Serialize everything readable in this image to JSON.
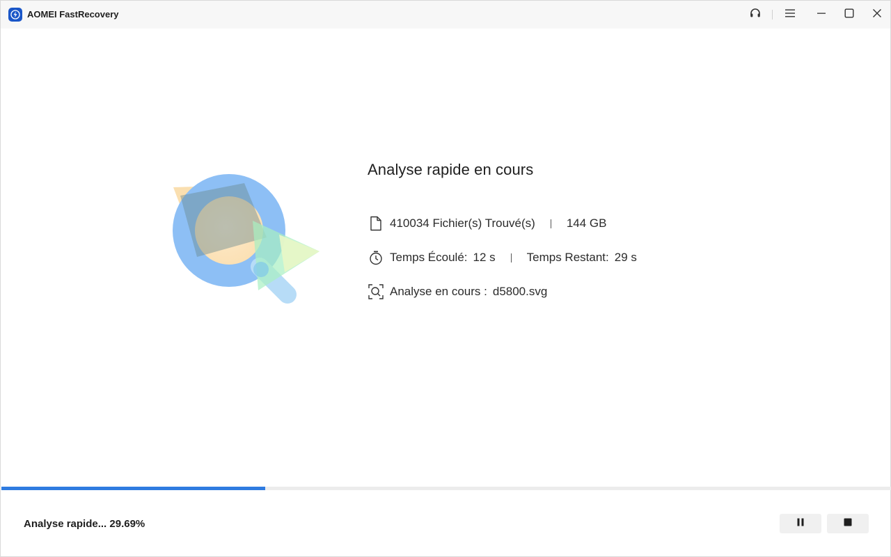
{
  "window": {
    "title": "AOMEI FastRecovery",
    "icons": [
      "lightning-logo-icon",
      "headset-icon",
      "menu-icon",
      "minimize-icon",
      "maximize-icon",
      "close-icon"
    ]
  },
  "scan": {
    "title": "Analyse rapide en cours",
    "files_found": "410034 Fichier(s) Trouvé(s)",
    "size": "144 GB",
    "elapsed_label": "Temps Écoulé:",
    "elapsed_value": "12 s",
    "remaining_label": "Temps Restant:",
    "remaining_value": "29 s",
    "current_label": "Analyse en cours :",
    "current_file": "d5800.svg"
  },
  "progress": {
    "percent": 29.69,
    "status_text": "Analyse rapide... 29.69%"
  },
  "colors": {
    "accent": "#2f7be0",
    "logo": "#1a56c8"
  }
}
